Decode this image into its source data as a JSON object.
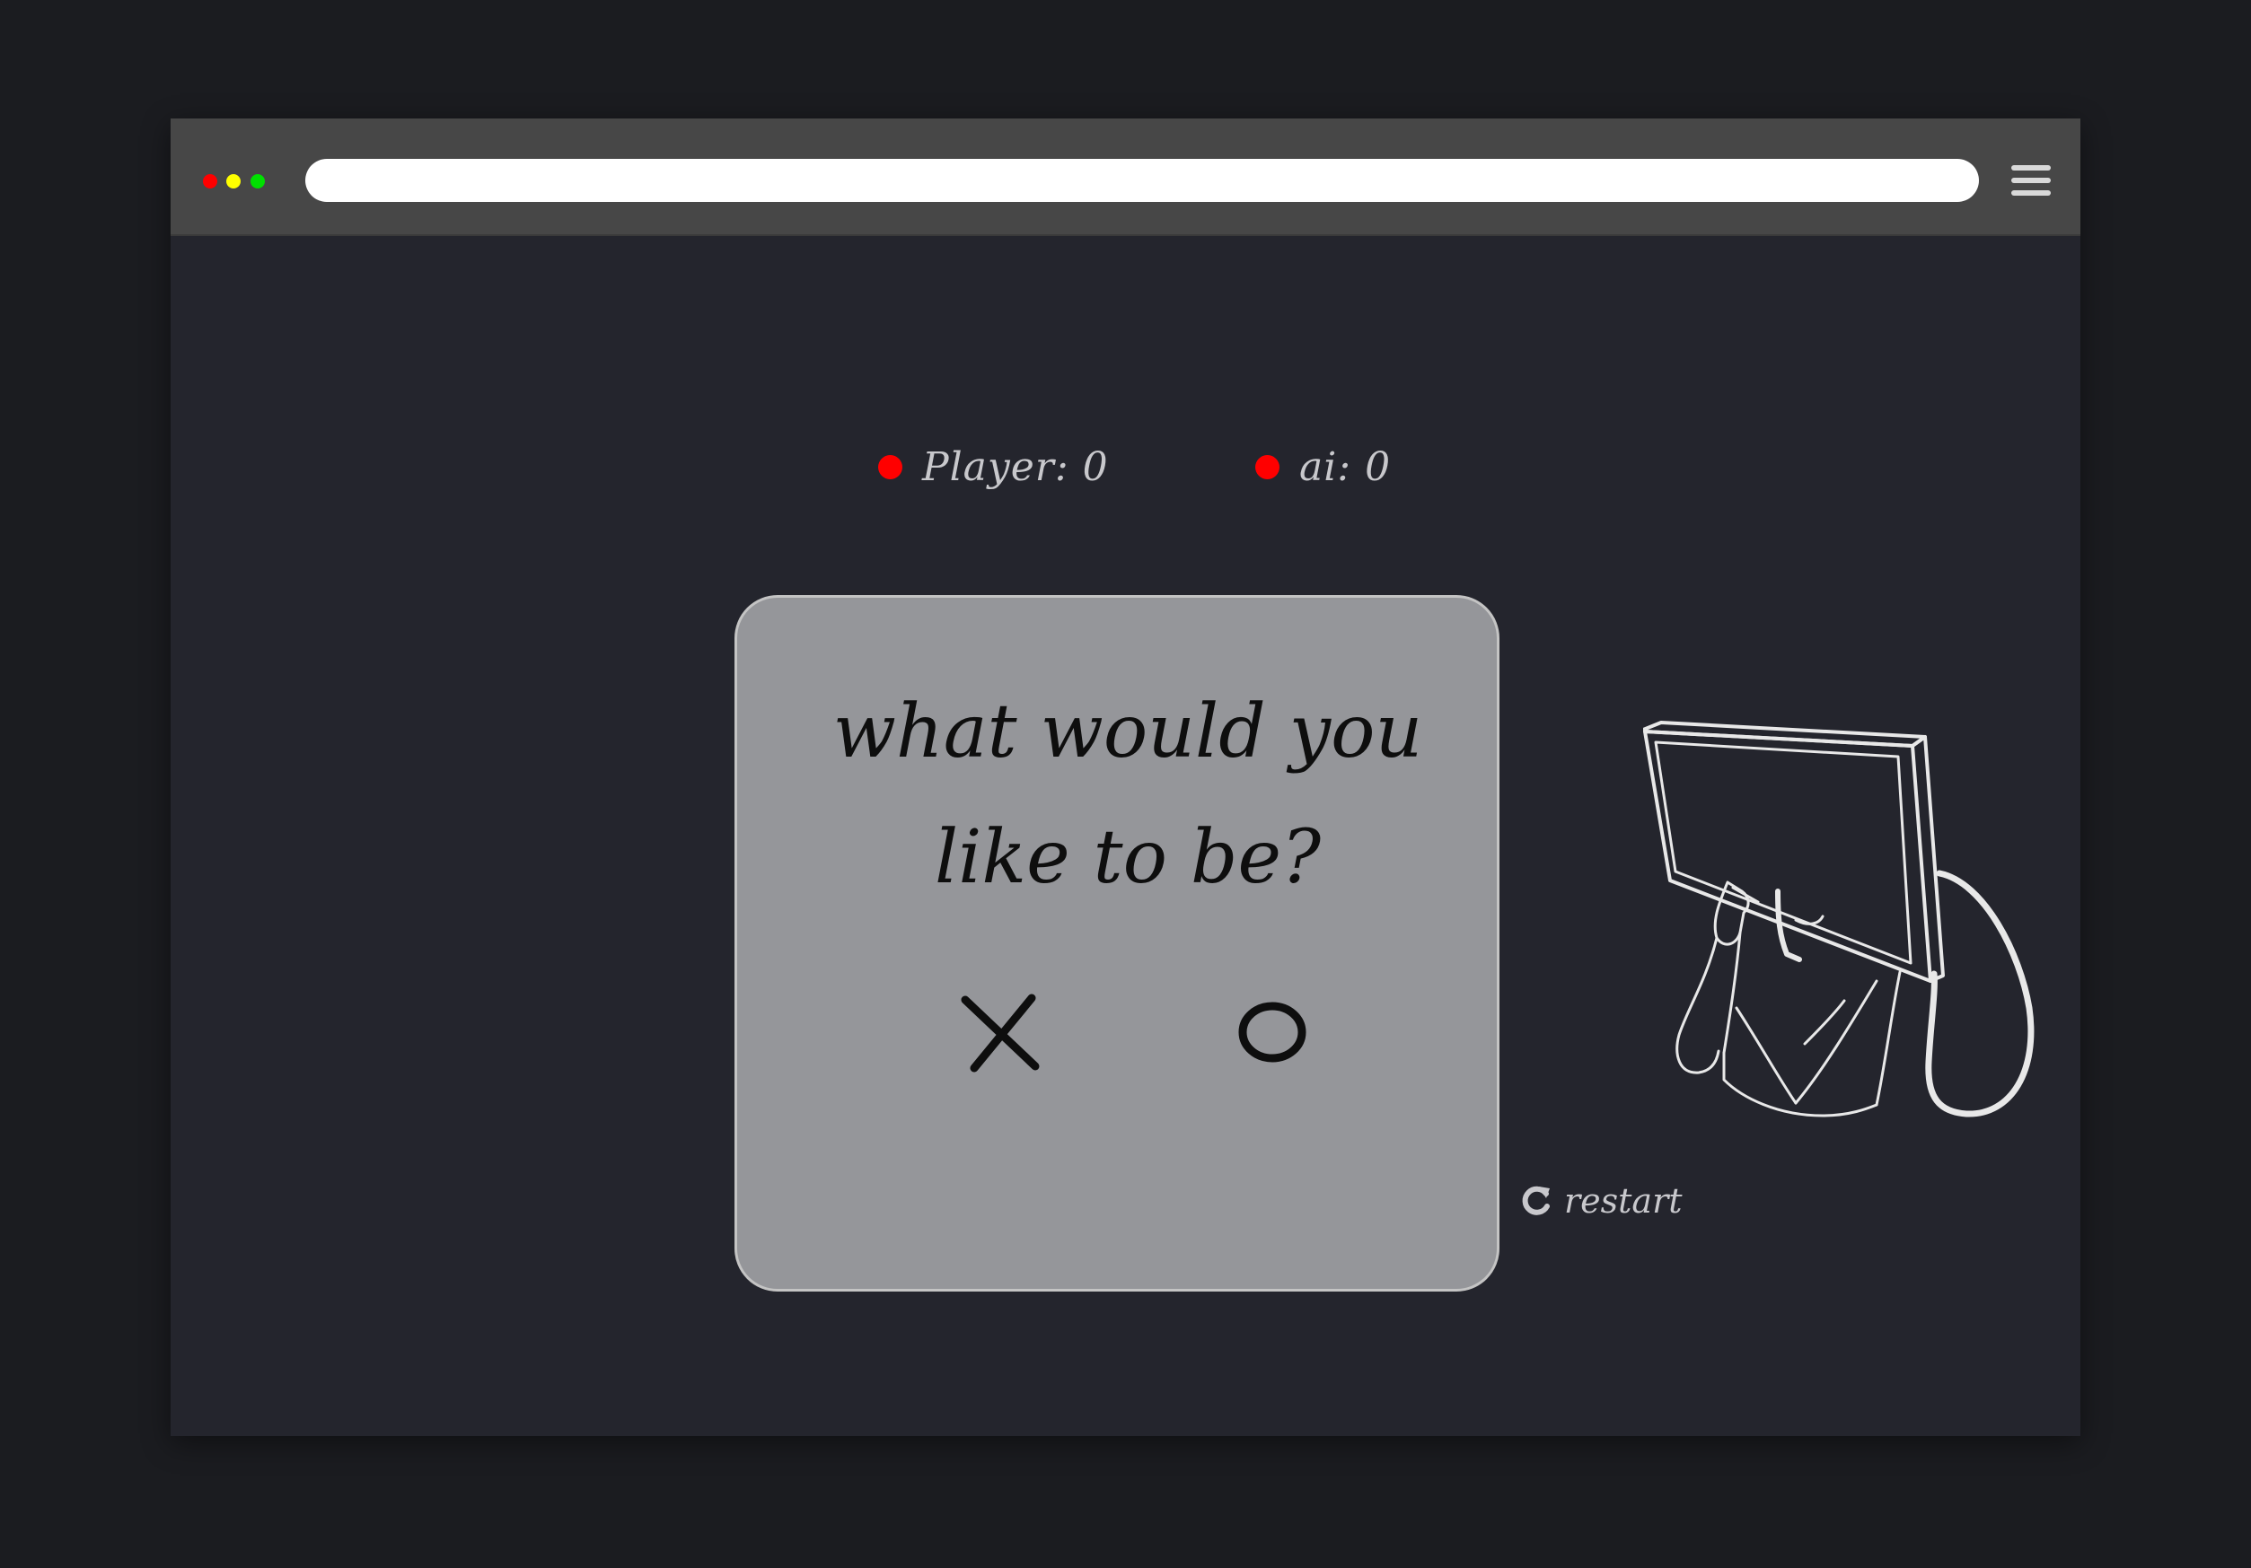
{
  "window": {
    "traffic_lights": {
      "red": "#ff0000",
      "yellow": "#ffff00",
      "green": "#00e000"
    },
    "address_bar": {
      "value": ""
    },
    "menu_icon": "hamburger-menu-icon"
  },
  "scoreboard": {
    "player": {
      "label": "Player: 0",
      "color": "#ff0000"
    },
    "ai": {
      "label": "ai: 0",
      "color": "#ff0000"
    }
  },
  "modal": {
    "question": "what would you like to be?",
    "options": [
      {
        "symbol": "X"
      },
      {
        "symbol": "O"
      }
    ]
  },
  "illustration": {
    "icon": "person-holding-monitor-illustration"
  },
  "restart": {
    "label": "restart",
    "icon": "refresh-icon"
  }
}
